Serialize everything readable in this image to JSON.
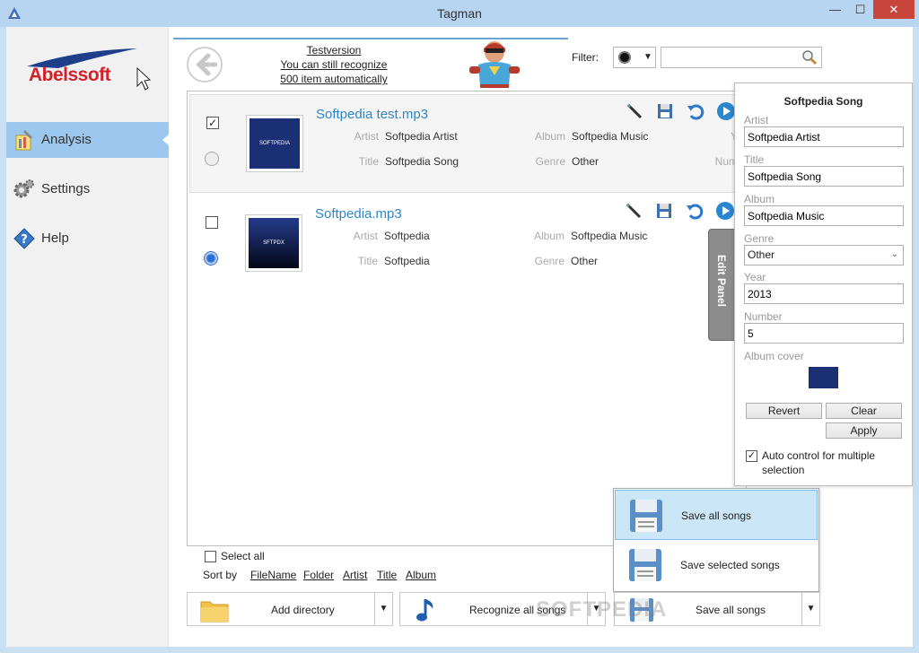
{
  "window": {
    "title": "Tagman",
    "minimize": "—",
    "maximize": "☐",
    "close": "✕"
  },
  "sidebar": {
    "logo": "Abelssoft",
    "items": [
      {
        "label": "Analysis",
        "icon": "analysis-icon",
        "active": true
      },
      {
        "label": "Settings",
        "icon": "gear-icon",
        "active": false
      },
      {
        "label": "Help",
        "icon": "help-icon",
        "active": false
      }
    ]
  },
  "header": {
    "notice": [
      "Testversion",
      "You can still recognize",
      "500 item automatically"
    ],
    "filter_label": "Filter:",
    "search_value": ""
  },
  "songs": [
    {
      "filename": "Softpedia test.mp3",
      "checked": true,
      "radio": false,
      "cover_text": "SOFTPEDIA",
      "artist_label": "Artist",
      "artist": "Softpedia Artist",
      "title_label": "Title",
      "title": "Softpedia Song",
      "album_label": "Album",
      "album": "Softpedia Music",
      "genre_label": "Genre",
      "genre": "Other",
      "year_label": "Y",
      "number_label": "Num"
    },
    {
      "filename": "Softpedia.mp3",
      "checked": false,
      "radio": true,
      "cover_text": "SFTPDX",
      "artist_label": "Artist",
      "artist": "Softpedia",
      "title_label": "Title",
      "title": "Softpedia",
      "album_label": "Album",
      "album": "Softpedia Music",
      "genre_label": "Genre",
      "genre": "Other"
    }
  ],
  "edit_panel": {
    "tab_label": "Edit Panel",
    "title": "Softpedia Song",
    "artist_label": "Artist",
    "artist": "Softpedia Artist",
    "title_label": "Title",
    "album_label": "Album",
    "album": "Softpedia Music",
    "genre_label": "Genre",
    "genre": "Other",
    "year_label": "Year",
    "year": "2013",
    "number_label": "Number",
    "number": "5",
    "cover_label": "Album cover",
    "revert": "Revert",
    "clear": "Clear",
    "apply": "Apply",
    "auto_control": "Auto control for multiple selection",
    "auto_control_checked": true
  },
  "save_menu": {
    "items": [
      {
        "label": "Save all songs"
      },
      {
        "label": "Save selected songs"
      }
    ]
  },
  "bottom": {
    "select_all": "Select all",
    "sort_by": "Sort by",
    "sort_links": [
      "FileName",
      "Folder",
      "Artist",
      "Title",
      "Album"
    ],
    "add_directory": "Add directory",
    "recognize_all": "Recognize all songs",
    "save_all": "Save all songs",
    "watermark": "SOFTPEDIA"
  },
  "colors": {
    "accent": "#2e86c7",
    "nav_active": "#9cc8ef",
    "close": "#c7453a",
    "brand": "#d2212b"
  }
}
